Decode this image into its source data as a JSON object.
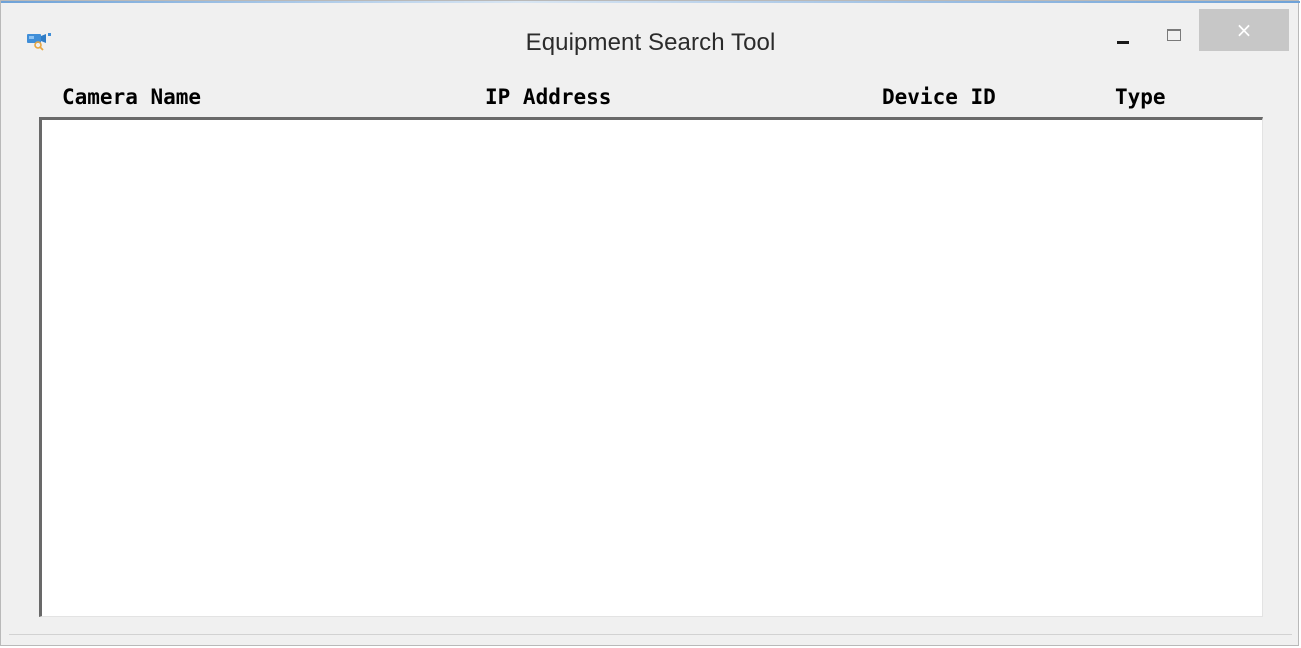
{
  "window": {
    "title": "Equipment Search Tool",
    "app_icon": "camera-search-icon",
    "controls": {
      "minimize_icon": "minimize-icon",
      "maximize_icon": "maximize-icon",
      "close_icon": "close-icon",
      "close_glyph": "×"
    }
  },
  "device_list": {
    "columns": [
      {
        "label": "Camera Name"
      },
      {
        "label": "IP Address"
      },
      {
        "label": "Device ID"
      },
      {
        "label": "Type"
      }
    ],
    "rows": []
  },
  "colors": {
    "window_bg": "#f0f0f0",
    "list_bg": "#ffffff",
    "close_button_bg": "#c7c7c7",
    "icon_blue": "#3f8ed8"
  }
}
